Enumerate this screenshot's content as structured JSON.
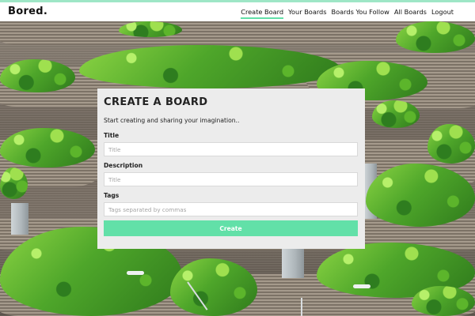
{
  "brand": {
    "logo_text": "Bored.",
    "accent_color": "#62e0a8"
  },
  "nav": {
    "links": [
      {
        "label": "Create Board",
        "active": true
      },
      {
        "label": "Your Boards"
      },
      {
        "label": "Boards You Follow"
      },
      {
        "label": "All Boards"
      },
      {
        "label": "Logout"
      }
    ]
  },
  "form": {
    "title": "CREATE A BOARD",
    "subtitle": "Start creating and sharing your imagination..",
    "fields": {
      "title": {
        "label": "Title",
        "placeholder": "Title",
        "value": ""
      },
      "description": {
        "label": "Description",
        "placeholder": "Title",
        "value": ""
      },
      "tags": {
        "label": "Tags",
        "placeholder": "Tags separated by commas",
        "value": ""
      }
    },
    "submit_label": "Create"
  }
}
